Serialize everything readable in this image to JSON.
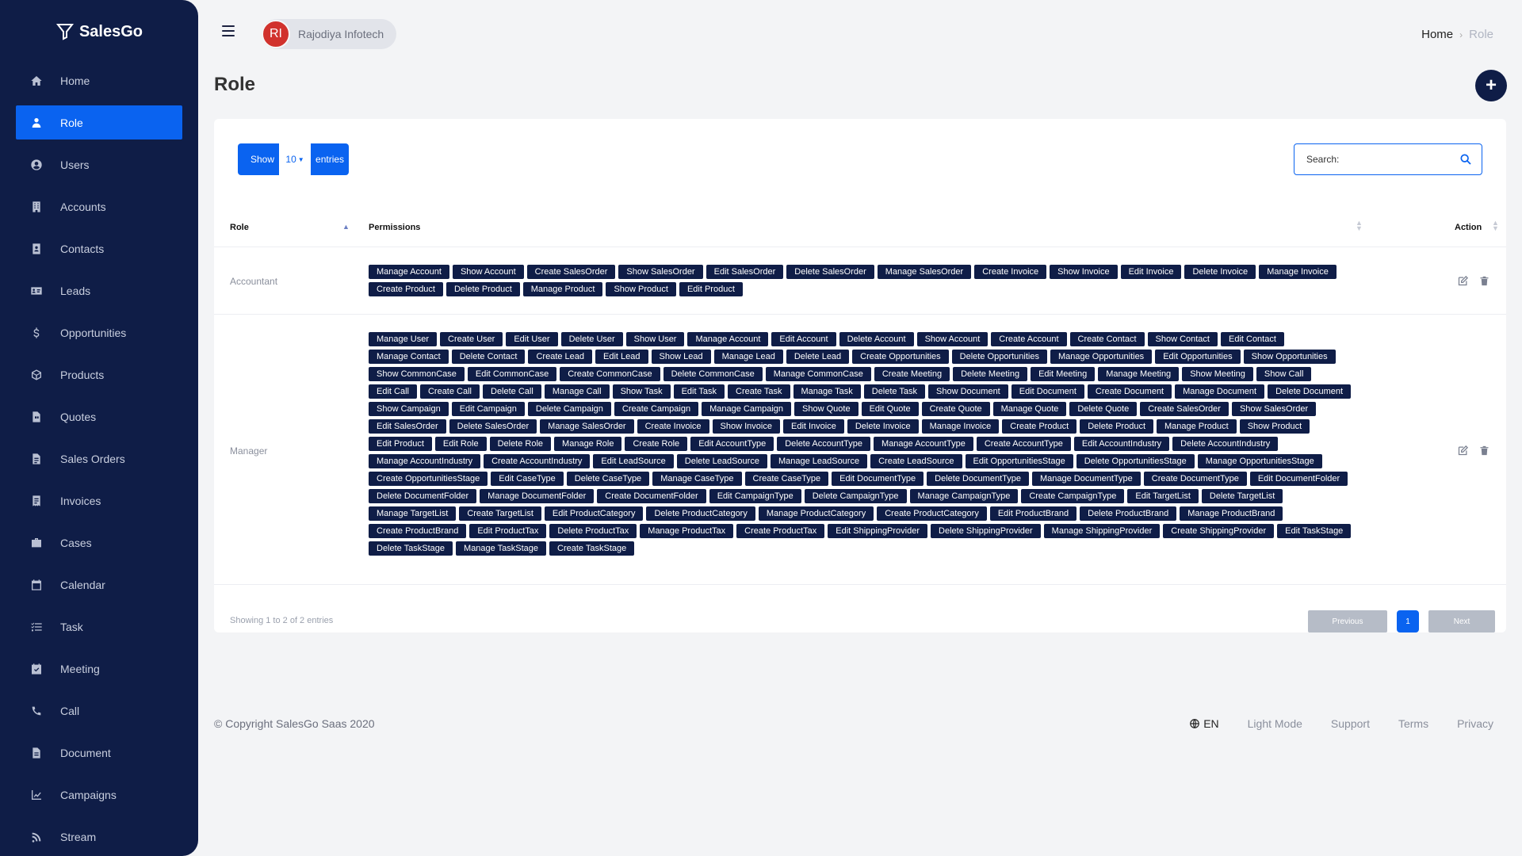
{
  "brand": {
    "name": "SalesGo"
  },
  "sidebar": {
    "items": [
      {
        "label": "Home",
        "icon": "home-icon"
      },
      {
        "label": "Role",
        "icon": "user-tie-icon",
        "active": true
      },
      {
        "label": "Users",
        "icon": "user-circle-icon"
      },
      {
        "label": "Accounts",
        "icon": "building-icon"
      },
      {
        "label": "Contacts",
        "icon": "contact-book-icon"
      },
      {
        "label": "Leads",
        "icon": "id-card-icon"
      },
      {
        "label": "Opportunities",
        "icon": "dollar-icon"
      },
      {
        "label": "Products",
        "icon": "box-icon"
      },
      {
        "label": "Quotes",
        "icon": "file-quote-icon"
      },
      {
        "label": "Sales Orders",
        "icon": "file-invoice-icon"
      },
      {
        "label": "Invoices",
        "icon": "receipt-icon"
      },
      {
        "label": "Cases",
        "icon": "briefcase-icon"
      },
      {
        "label": "Calendar",
        "icon": "calendar-icon"
      },
      {
        "label": "Task",
        "icon": "tasks-icon"
      },
      {
        "label": "Meeting",
        "icon": "calendar-check-icon"
      },
      {
        "label": "Call",
        "icon": "phone-icon"
      },
      {
        "label": "Document",
        "icon": "document-icon"
      },
      {
        "label": "Campaigns",
        "icon": "chart-line-icon"
      },
      {
        "label": "Stream",
        "icon": "rss-icon"
      }
    ]
  },
  "header": {
    "org_initials": "RI",
    "org_name": "Rajodiya Infotech",
    "breadcrumb_home": "Home",
    "breadcrumb_current": "Role"
  },
  "page": {
    "title": "Role"
  },
  "table_controls": {
    "show_label": "Show",
    "length_value": "10",
    "entries_label": "entries",
    "search_label": "Search:"
  },
  "table": {
    "headers": {
      "role": "Role",
      "permissions": "Permissions",
      "action": "Action"
    },
    "rows": [
      {
        "role": "Accountant",
        "permissions": [
          "Manage Account",
          "Show Account",
          "Create SalesOrder",
          "Show SalesOrder",
          "Edit SalesOrder",
          "Delete SalesOrder",
          "Manage SalesOrder",
          "Create Invoice",
          "Show Invoice",
          "Edit Invoice",
          "Delete Invoice",
          "Manage Invoice",
          "Create Product",
          "Delete Product",
          "Manage Product",
          "Show Product",
          "Edit Product"
        ]
      },
      {
        "role": "Manager",
        "permissions": [
          "Manage User",
          "Create User",
          "Edit User",
          "Delete User",
          "Show User",
          "Manage Account",
          "Edit Account",
          "Delete Account",
          "Show Account",
          "Create Account",
          "Create Contact",
          "Show Contact",
          "Edit Contact",
          "Manage Contact",
          "Delete Contact",
          "Create Lead",
          "Edit Lead",
          "Show Lead",
          "Manage Lead",
          "Delete Lead",
          "Create Opportunities",
          "Delete Opportunities",
          "Manage Opportunities",
          "Edit Opportunities",
          "Show Opportunities",
          "Show CommonCase",
          "Edit CommonCase",
          "Create CommonCase",
          "Delete CommonCase",
          "Manage CommonCase",
          "Create Meeting",
          "Delete Meeting",
          "Edit Meeting",
          "Manage Meeting",
          "Show Meeting",
          "Show Call",
          "Edit Call",
          "Create Call",
          "Delete Call",
          "Manage Call",
          "Show Task",
          "Edit Task",
          "Create Task",
          "Manage Task",
          "Delete Task",
          "Show Document",
          "Edit Document",
          "Create Document",
          "Manage Document",
          "Delete Document",
          "Show Campaign",
          "Edit Campaign",
          "Delete Campaign",
          "Create Campaign",
          "Manage Campaign",
          "Show Quote",
          "Edit Quote",
          "Create Quote",
          "Manage Quote",
          "Delete Quote",
          "Create SalesOrder",
          "Show SalesOrder",
          "Edit SalesOrder",
          "Delete SalesOrder",
          "Manage SalesOrder",
          "Create Invoice",
          "Show Invoice",
          "Edit Invoice",
          "Delete Invoice",
          "Manage Invoice",
          "Create Product",
          "Delete Product",
          "Manage Product",
          "Show Product",
          "Edit Product",
          "Edit Role",
          "Delete Role",
          "Manage Role",
          "Create Role",
          "Edit AccountType",
          "Delete AccountType",
          "Manage AccountType",
          "Create AccountType",
          "Edit AccountIndustry",
          "Delete AccountIndustry",
          "Manage AccountIndustry",
          "Create AccountIndustry",
          "Edit LeadSource",
          "Delete LeadSource",
          "Manage LeadSource",
          "Create LeadSource",
          "Edit OpportunitiesStage",
          "Delete OpportunitiesStage",
          "Manage OpportunitiesStage",
          "Create OpportunitiesStage",
          "Edit CaseType",
          "Delete CaseType",
          "Manage CaseType",
          "Create CaseType",
          "Edit DocumentType",
          "Delete DocumentType",
          "Manage DocumentType",
          "Create DocumentType",
          "Edit DocumentFolder",
          "Delete DocumentFolder",
          "Manage DocumentFolder",
          "Create DocumentFolder",
          "Edit CampaignType",
          "Delete CampaignType",
          "Manage CampaignType",
          "Create CampaignType",
          "Edit TargetList",
          "Delete TargetList",
          "Manage TargetList",
          "Create TargetList",
          "Edit ProductCategory",
          "Delete ProductCategory",
          "Manage ProductCategory",
          "Create ProductCategory",
          "Edit ProductBrand",
          "Delete ProductBrand",
          "Manage ProductBrand",
          "Create ProductBrand",
          "Edit ProductTax",
          "Delete ProductTax",
          "Manage ProductTax",
          "Create ProductTax",
          "Edit ShippingProvider",
          "Delete ShippingProvider",
          "Manage ShippingProvider",
          "Create ShippingProvider",
          "Edit TaskStage",
          "Delete TaskStage",
          "Manage TaskStage",
          "Create TaskStage"
        ]
      }
    ]
  },
  "pagination": {
    "info": "Showing 1 to 2 of 2 entries",
    "previous": "Previous",
    "page": "1",
    "next": "Next"
  },
  "footer": {
    "copyright": "© Copyright SalesGo Saas 2020",
    "lang": "EN",
    "light_mode": "Light Mode",
    "support": "Support",
    "terms": "Terms",
    "privacy": "Privacy"
  },
  "colors": {
    "sidebar_bg": "#0f1d47",
    "accent": "#0a63f0",
    "tag_bg": "#0f1d47",
    "avatar_bg": "#d1322d"
  }
}
